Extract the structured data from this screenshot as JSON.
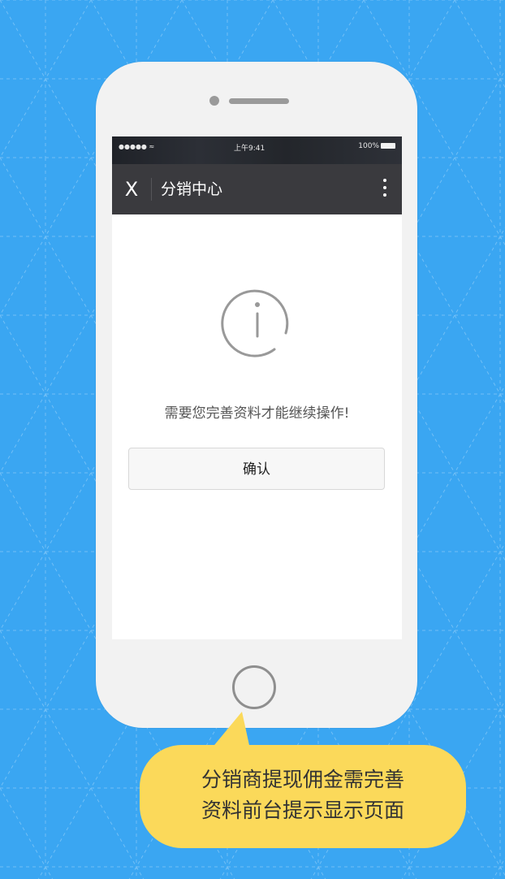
{
  "status_bar": {
    "signal": "●●●●● ≈",
    "time": "上午9:41",
    "battery": "100%"
  },
  "nav": {
    "close_label": "X",
    "title": "分销中心"
  },
  "content": {
    "message": "需要您完善资料才能继续操作!",
    "confirm_label": "确认"
  },
  "callout": {
    "line1": "分销商提现佣金需完善",
    "line2": "资料前台提示显示页面"
  },
  "icons": {
    "info": "info-icon",
    "more": "more-vertical-icon",
    "close": "close-icon"
  },
  "colors": {
    "background": "#3aa6f2",
    "nav_bar": "#3a3a3e",
    "callout": "#fbd95a"
  }
}
